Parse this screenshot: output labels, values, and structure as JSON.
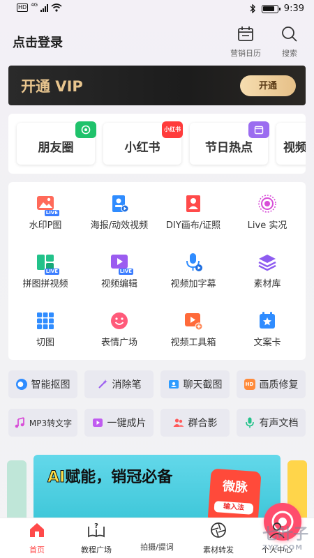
{
  "statusbar": {
    "hd": "HD",
    "network": "4G",
    "time": "9:39"
  },
  "header": {
    "login": "点击登录",
    "calendar_label": "营销日历",
    "search_label": "搜索"
  },
  "vip": {
    "title": "开通 VIP",
    "button": "开通"
  },
  "platforms": [
    {
      "label": "朋友圈",
      "badge": "",
      "badge_color": "#1fc26b"
    },
    {
      "label": "小红书",
      "badge": "小红书",
      "badge_color": "#ff3b3b"
    },
    {
      "label": "节日热点",
      "badge": "",
      "badge_color": "#9b6cf0"
    },
    {
      "label": "视频"
    }
  ],
  "tools": [
    {
      "label": "水印P图",
      "icon": "image-live-icon",
      "color": "#ff5a5a",
      "live": "LIVE"
    },
    {
      "label": "海报/动效视频",
      "icon": "poster-video-icon",
      "color": "#2f8cff"
    },
    {
      "label": "DIY画布/证照",
      "icon": "id-photo-icon",
      "color": "#ff4a4a"
    },
    {
      "label": "Live 实况",
      "icon": "live-photo-icon",
      "color": "#d84fd8"
    },
    {
      "label": "拼图拼视频",
      "icon": "collage-live-icon",
      "color": "#22c28a",
      "live": "LIVE"
    },
    {
      "label": "视频编辑",
      "icon": "video-edit-live-icon",
      "color": "#9b5cf0",
      "live": "LIVE"
    },
    {
      "label": "视频加字幕",
      "icon": "mic-subtitle-icon",
      "color": "#2f8cff"
    },
    {
      "label": "素材库",
      "icon": "layers-icon",
      "color": "#8e5cf0"
    },
    {
      "label": "切图",
      "icon": "grid-cut-icon",
      "color": "#2f8cff"
    },
    {
      "label": "表情广场",
      "icon": "smile-icon",
      "color": "#ff5a7a"
    },
    {
      "label": "视频工具箱",
      "icon": "video-toolbox-icon",
      "color": "#ff6a3a"
    },
    {
      "label": "文案卡",
      "icon": "star-card-icon",
      "color": "#2f8cff"
    }
  ],
  "chips": [
    {
      "label": "智能抠图",
      "color": "#2f8cff"
    },
    {
      "label": "消除笔",
      "color": "#9b5cf0"
    },
    {
      "label": "聊天截图",
      "color": "#2f9cff"
    },
    {
      "label": "画质修复",
      "color": "#ff8a3a"
    },
    {
      "label": "MP3转文字",
      "color": "#d84fd8"
    },
    {
      "label": "一键成片",
      "color": "#c05cf0"
    },
    {
      "label": "群合影",
      "color": "#ff5a5a"
    },
    {
      "label": "有声文档",
      "color": "#22c28a"
    }
  ],
  "banner": {
    "title_ai": "AI",
    "title_rest": "赋能，销冠必备",
    "logo_text": "微脉",
    "logo_sub": "输入法"
  },
  "nav": [
    {
      "label": "首页",
      "active": true
    },
    {
      "label": "教程广场"
    },
    {
      "label": "拍摄/提词"
    },
    {
      "label": "素材转发"
    },
    {
      "label": "个人中心"
    }
  ],
  "watermark": {
    "text": "七叶子",
    "sub": "7YZ.COM"
  }
}
